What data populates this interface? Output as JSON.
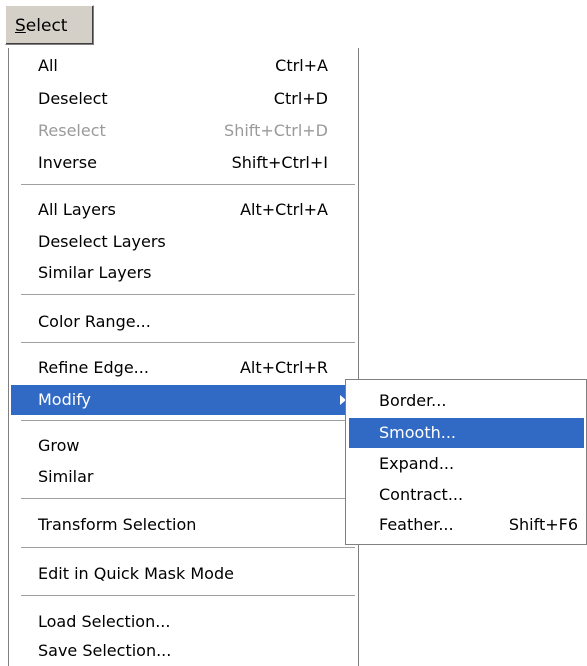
{
  "menubar": {
    "select_accel": "S",
    "select_rest": "elect"
  },
  "menu": {
    "items": [
      {
        "label": "All",
        "shortcut": "Ctrl+A"
      },
      {
        "label": "Deselect",
        "shortcut": "Ctrl+D"
      },
      {
        "label": "Reselect",
        "shortcut": "Shift+Ctrl+D"
      },
      {
        "label": "Inverse",
        "shortcut": "Shift+Ctrl+I"
      },
      {
        "label": "All Layers",
        "shortcut": "Alt+Ctrl+A"
      },
      {
        "label": "Deselect Layers",
        "shortcut": ""
      },
      {
        "label": "Similar Layers",
        "shortcut": ""
      },
      {
        "label": "Color Range...",
        "shortcut": ""
      },
      {
        "label": "Refine Edge...",
        "shortcut": "Alt+Ctrl+R"
      },
      {
        "label": "Modify",
        "shortcut": ""
      },
      {
        "label": "Grow",
        "shortcut": ""
      },
      {
        "label": "Similar",
        "shortcut": ""
      },
      {
        "label": "Transform Selection",
        "shortcut": ""
      },
      {
        "label": "Edit in Quick Mask Mode",
        "shortcut": ""
      },
      {
        "label": "Load Selection...",
        "shortcut": ""
      },
      {
        "label": "Save Selection...",
        "shortcut": ""
      }
    ]
  },
  "submenu": {
    "items": [
      {
        "label": "Border...",
        "shortcut": ""
      },
      {
        "label": "Smooth...",
        "shortcut": ""
      },
      {
        "label": "Expand...",
        "shortcut": ""
      },
      {
        "label": "Contract...",
        "shortcut": ""
      },
      {
        "label": "Feather...",
        "shortcut": "Shift+F6"
      }
    ]
  },
  "icons": {
    "submenu_arrow": "chevron-right-icon"
  },
  "colors": {
    "highlight": "#316ac5",
    "disabled_text": "#9a9a9a",
    "menubar_button": "#d4d0c8"
  }
}
